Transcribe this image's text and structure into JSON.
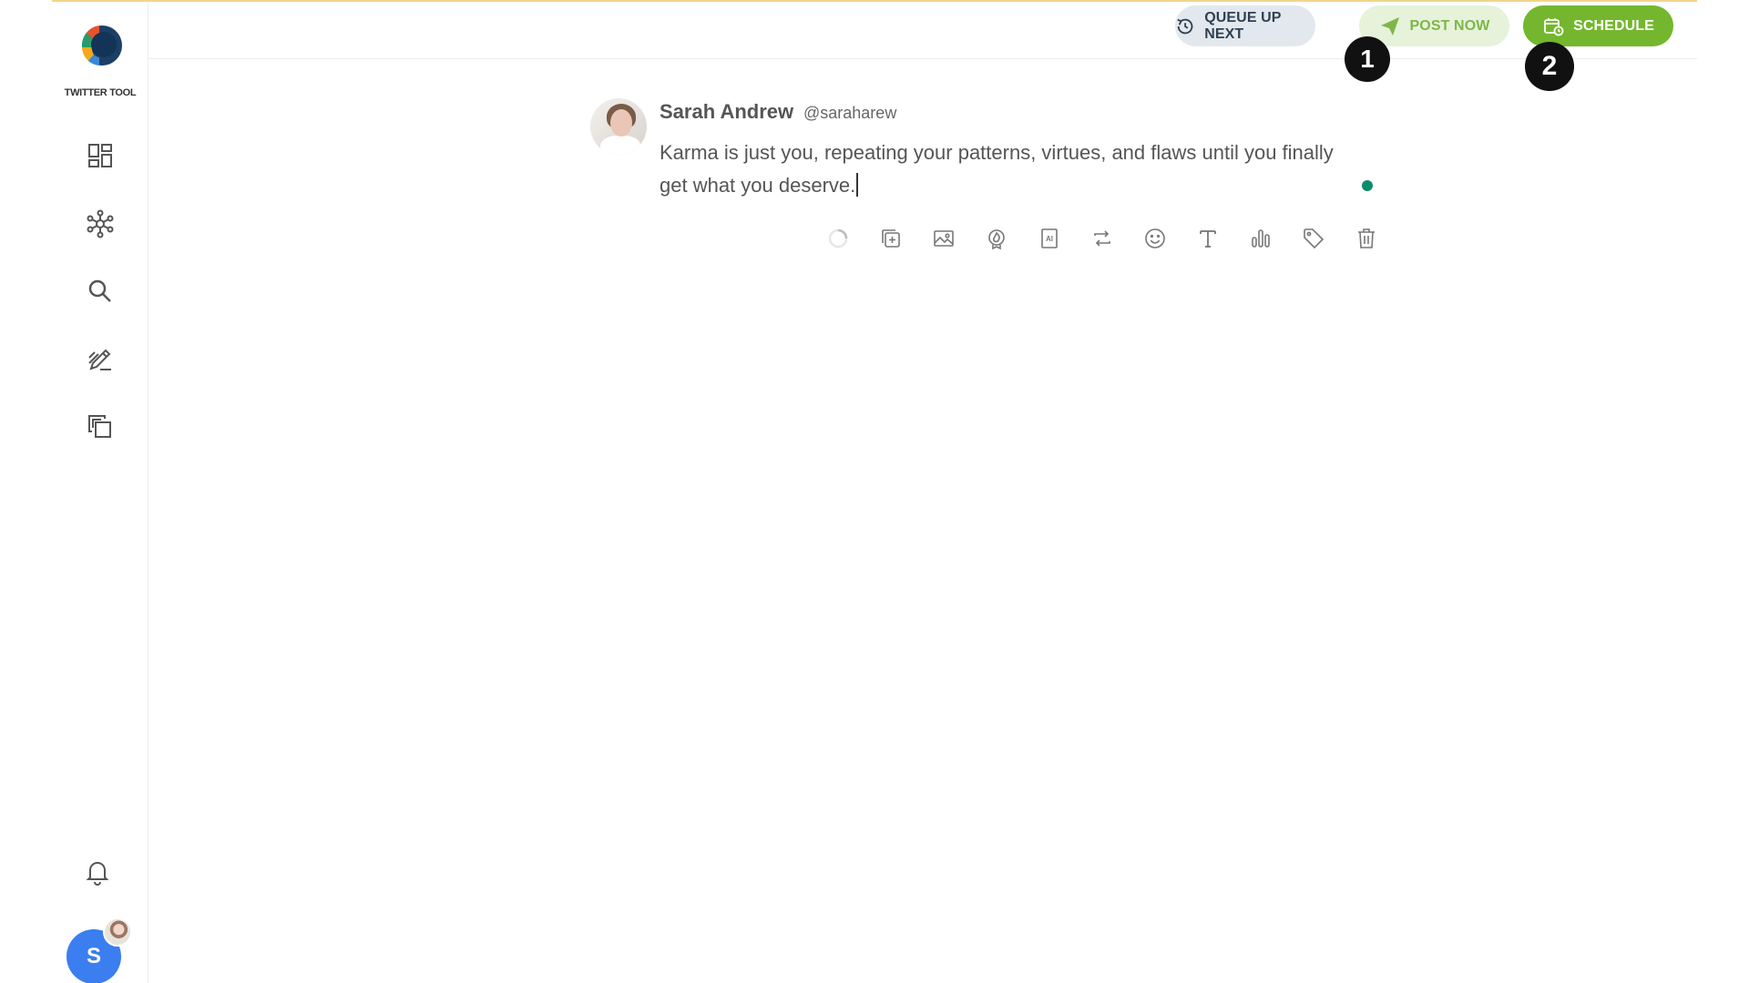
{
  "app": {
    "logo_text": "TWITTER TOOL"
  },
  "sidebar": {
    "items": [
      {
        "icon": "dashboard-icon"
      },
      {
        "icon": "network-icon"
      },
      {
        "icon": "search-icon"
      },
      {
        "icon": "compose-icon"
      },
      {
        "icon": "copy-icon"
      }
    ],
    "bell_icon": "bell-icon",
    "user_initial": "S"
  },
  "header": {
    "queue_label": "QUEUE UP NEXT",
    "post_label": "POST NOW",
    "schedule_label": "SCHEDULE"
  },
  "markers": {
    "one": "1",
    "two": "2"
  },
  "post": {
    "author_name": "Sarah Andrew",
    "author_handle": "@saraharew",
    "text": "Karma is just you, repeating your patterns, virtues, and flaws until you finally get what you deserve."
  },
  "toolbar": {
    "icons": [
      "spinner-icon",
      "add-thread-icon",
      "image-icon",
      "fire-icon",
      "ai-icon",
      "retweet-icon",
      "emoji-icon",
      "text-format-icon",
      "poll-icon",
      "tag-icon",
      "trash-icon"
    ]
  },
  "colors": {
    "accent_green": "#74b72e",
    "light_green": "#e6f2da",
    "queue_bg": "#e3e8ee",
    "avatar_blue": "#3b7ef0",
    "status_dot": "#0e8c6a"
  }
}
